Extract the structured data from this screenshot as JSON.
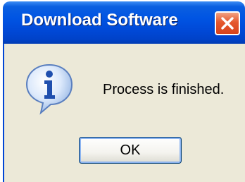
{
  "dialog": {
    "title": "Download Software",
    "message": "Process is finished.",
    "ok_label": "OK"
  },
  "icons": {
    "status": "info-icon",
    "close": "close-icon"
  },
  "colors": {
    "titlebar": "#0054e3",
    "close_button": "#e5582e",
    "client_background": "#ece9d8"
  }
}
